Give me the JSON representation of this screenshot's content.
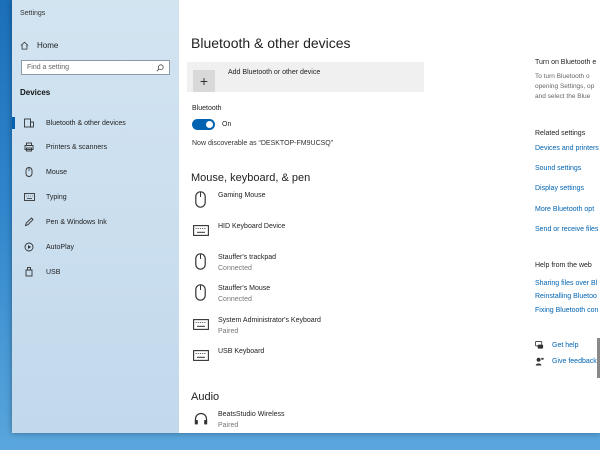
{
  "app": {
    "title": "Settings"
  },
  "sidebar": {
    "home_label": "Home",
    "search_placeholder": "Find a setting",
    "section_label": "Devices",
    "items": [
      {
        "label": "Bluetooth & other devices",
        "icon": "bluetooth-devices-icon",
        "active": true
      },
      {
        "label": "Printers & scanners",
        "icon": "printer-icon"
      },
      {
        "label": "Mouse",
        "icon": "mouse-icon"
      },
      {
        "label": "Typing",
        "icon": "keyboard-icon"
      },
      {
        "label": "Pen & Windows Ink",
        "icon": "pen-icon"
      },
      {
        "label": "AutoPlay",
        "icon": "autoplay-icon"
      },
      {
        "label": "USB",
        "icon": "usb-icon"
      }
    ]
  },
  "main": {
    "title": "Bluetooth & other devices",
    "add_button": "Add Bluetooth or other device",
    "bluetooth_label": "Bluetooth",
    "toggle_state": "On",
    "discoverable": "Now discoverable as “DESKTOP-FM9UCSQ”",
    "sections": {
      "mkp": "Mouse, keyboard, & pen",
      "audio": "Audio"
    },
    "devices": [
      {
        "name": "Gaming Mouse",
        "status": "",
        "icon": "mouse-icon"
      },
      {
        "name": "HID Keyboard Device",
        "status": "",
        "icon": "keyboard-icon"
      },
      {
        "name": "Stauffer's trackpad",
        "status": "Connected",
        "icon": "mouse-icon"
      },
      {
        "name": "Stauffer's Mouse",
        "status": "Connected",
        "icon": "mouse-icon"
      },
      {
        "name": "System Administrator's Keyboard",
        "status": "Paired",
        "icon": "keyboard-icon"
      },
      {
        "name": "USB Keyboard",
        "status": "",
        "icon": "keyboard-icon"
      }
    ],
    "audio_devices": [
      {
        "name": "BeatsStudio Wireless",
        "status": "Paired",
        "icon": "headphones-icon"
      }
    ]
  },
  "right_panel": {
    "swift_title": "Turn on Bluetooth e",
    "swift_desc": [
      "To turn Bluetooth o",
      "opening Settings, op",
      "and select the Blue"
    ],
    "related_title": "Related settings",
    "related_links": [
      "Devices and printers",
      "Sound settings",
      "Display settings",
      "More Bluetooth opt",
      "Send or receive files"
    ],
    "web_title": "Help from the web",
    "web_links": [
      "Sharing files over Bl",
      "Reinstalling Bluetoo",
      "Fixing Bluetooth con"
    ],
    "help": [
      {
        "label": "Get help",
        "icon": "chat-help-icon"
      },
      {
        "label": "Give feedback",
        "icon": "feedback-icon"
      }
    ]
  },
  "colors": {
    "accent": "#0063b1",
    "sidebar_bg": "#c8dcee",
    "desktop": "#2f86cc"
  }
}
